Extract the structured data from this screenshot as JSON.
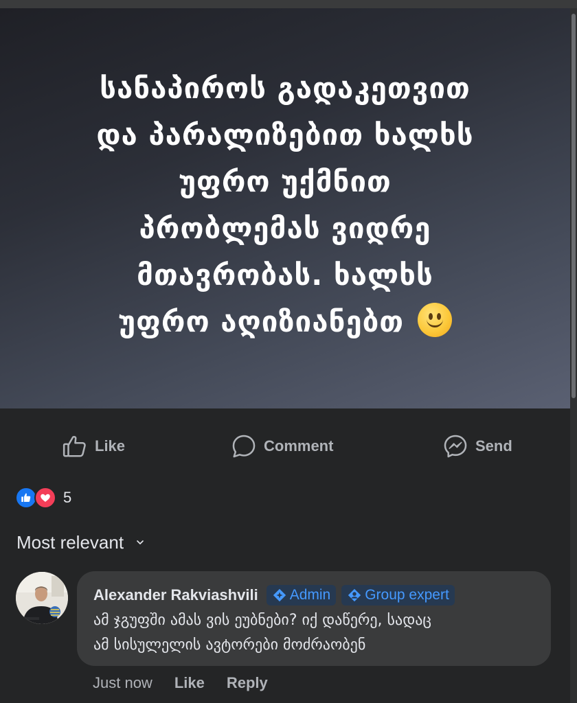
{
  "post": {
    "image_text_lines": [
      "სანაპიროს გადაკეთვით",
      "და პარალიზებით ხალხს",
      "უფრო უქმნით",
      "პრობლემას ვიდრე",
      "მთავრობას. ხალხს",
      "უფრო აღიზიანებთ"
    ]
  },
  "actions": {
    "like_label": "Like",
    "comment_label": "Comment",
    "send_label": "Send"
  },
  "reactions": {
    "count": "5"
  },
  "sort": {
    "label": "Most relevant"
  },
  "comment": {
    "author": "Alexander Rakviashvili",
    "badges": [
      "Admin",
      "Group expert"
    ],
    "text_line1": "ამ ჯგუფში ამას ვის ეუბნები? იქ დაწერე, სადაც",
    "text_line2": "ამ სისულელის ავტორები მოძრაობენ",
    "time": "Just now",
    "like_label": "Like",
    "reply_label": "Reply"
  },
  "colors": {
    "background": "#242526",
    "bubble": "#3a3b3c",
    "badge_text": "#4599ff",
    "like_blue": "#1877f2",
    "love_red": "#f33e58"
  },
  "icons": [
    "thumbs-up-icon",
    "comment-icon",
    "messenger-icon",
    "like-reaction-icon",
    "love-reaction-icon",
    "chevron-down-icon",
    "diamond-badge-icon"
  ]
}
